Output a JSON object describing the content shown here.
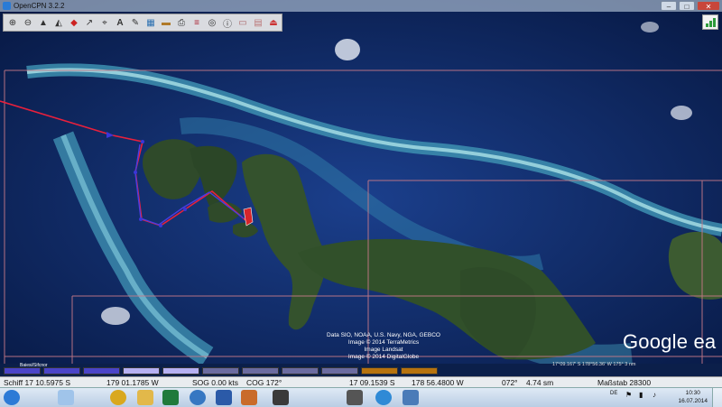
{
  "window": {
    "title": "OpenCPN 3.2.2",
    "controls": {
      "minimize": "–",
      "maximize": "□",
      "close": "✕"
    }
  },
  "toolbar": {
    "icons": [
      "zoom-in-icon",
      "zoom-out-icon",
      "scale-up-icon",
      "scale-down-icon",
      "route-icon",
      "wind-icon",
      "mark-icon",
      "text-icon",
      "course-icon",
      "tide-icon",
      "current-icon",
      "print-icon",
      "route-manager-icon",
      "ais-icon",
      "info-icon",
      "settings-icon",
      "stats-icon",
      "exit-icon"
    ]
  },
  "map": {
    "attribution": [
      "Data SIO, NOAA, U.S. Navy, NGA, GEBCO",
      "Image © 2014 TerraMetrics",
      "Image Landsat",
      "Image © 2014 DigitalGlobe"
    ],
    "google_logo": "Google ea",
    "scale_label": "Baiesi/Sifcnor",
    "cursor_readout": "17°09.167' S  178°56.36' W  175°   3 nm",
    "colors": {
      "route": "#e8203c",
      "track": "#4a3de0",
      "boat": "#d6252a",
      "grid": "#c87a88"
    }
  },
  "chart_bar": {
    "keys": [
      {
        "color": "#4b44c8"
      },
      {
        "color": "#4b44c8"
      },
      {
        "color": "#4b44c8"
      },
      {
        "color": "#b6b0f2"
      },
      {
        "color": "#b6b0f2"
      },
      {
        "color": "#6b6ba0"
      },
      {
        "color": "#6b6ba0"
      },
      {
        "color": "#6b6ba0"
      },
      {
        "color": "#6b6ba0"
      },
      {
        "color": "#b7730e"
      },
      {
        "color": "#b7730e"
      }
    ]
  },
  "status": {
    "ship": "Schiff 17 10.5975 S",
    "ship_lon": "179 01.1785 W",
    "sog": "SOG 0.00 kts",
    "cog": "COG 172°",
    "cursor_lat": "17 09.1539 S",
    "cursor_lon": "178 56.4800 W",
    "bearing": "072°",
    "distance": "4.74 sm",
    "scale": "Maßstab 28300"
  },
  "taskbar": {
    "apps": [
      {
        "icon": "start-orb-icon",
        "color": "#2c7ad6"
      },
      {
        "icon": "sailboat-icon",
        "color": "#a0c4ea"
      },
      {
        "icon": "chrome-icon",
        "color": "#d9a81e"
      },
      {
        "icon": "explorer-icon",
        "color": "#e2b84a"
      },
      {
        "icon": "excel-icon",
        "color": "#1f7a3b"
      },
      {
        "icon": "globe-icon",
        "color": "#3677c2"
      },
      {
        "icon": "word-icon",
        "color": "#2b5aa8"
      },
      {
        "icon": "paint-icon",
        "color": "#c96b2a"
      },
      {
        "icon": "media-icon",
        "color": "#3a3a3a"
      },
      {
        "icon": "player-icon",
        "color": "#555555"
      },
      {
        "icon": "ie-icon",
        "color": "#2f8ad6"
      },
      {
        "icon": "opencpn-icon",
        "color": "#4a7bb8"
      }
    ],
    "tray": {
      "lang": "DE"
    },
    "clock": {
      "time": "10:30",
      "date": "16.07.2014"
    }
  }
}
